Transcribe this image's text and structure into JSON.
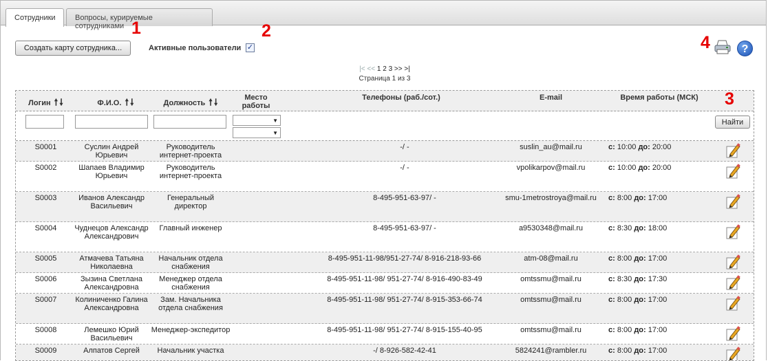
{
  "tabs": [
    {
      "label": "Сотрудники",
      "active": true
    },
    {
      "label": "Вопросы, курируемые сотрудниками",
      "active": false
    }
  ],
  "annotations": [
    "1",
    "2",
    "3",
    "4"
  ],
  "toolbar": {
    "create_button": "Создать карту сотрудника...",
    "active_users_label": "Активные пользователи",
    "active_users_checked": true
  },
  "icons": {
    "print": "printer-icon",
    "help": "help-icon",
    "help_glyph": "?",
    "check_glyph": "✓"
  },
  "pager": {
    "first": "|<",
    "prev": "<<",
    "pages": [
      "1",
      "2",
      "3"
    ],
    "next": ">>",
    "last": ">|",
    "summary": "Страница 1 из 3"
  },
  "table": {
    "headers": {
      "login": "Логин",
      "fio": "Ф.И.О.",
      "position": "Должность",
      "place": "Место работы",
      "phones": "Телефоны (раб./сот.)",
      "email": "E-mail",
      "hours": "Время работы (МСК)"
    },
    "sort_up": "🠕",
    "sort_down": "🠗",
    "find_button": "Найти",
    "from_label": "с:",
    "to_label": "до:",
    "rows": [
      {
        "login": "S0001",
        "fio": "Суслин Андрей Юрьевич",
        "position": "Руководитель интернет-проекта",
        "phones": "-/ -",
        "email": "suslin_au@mail.ru",
        "from": "10:00",
        "to": "20:00"
      },
      {
        "login": "S0002",
        "fio": "Шапаев Владимир Юрьевич",
        "position": "Руководитель интернет-проекта",
        "phones": "-/ -",
        "email": "vpolikarpov@mail.ru",
        "from": "10:00",
        "to": "20:00"
      },
      {
        "login": "S0003",
        "fio": "Иванов Александр Васильевич",
        "position": "Генеральный директор",
        "phones": "8-495-951-63-97/ -",
        "email": "smu-1metrostroya@mail.ru",
        "from": "8:00",
        "to": "17:00"
      },
      {
        "login": "S0004",
        "fio": "Чуднецов Александр Александрович",
        "position": "Главный инженер",
        "phones": "8-495-951-63-97/ -",
        "email": "a9530348@mail.ru",
        "from": "8:30",
        "to": "18:00"
      },
      {
        "login": "S0005",
        "fio": "Атмачева Татьяна Николаевна",
        "position": "Начальник отдела снабжения",
        "phones": "8-495-951-11-98/951-27-74/ 8-916-218-93-66",
        "email": "atm-08@mail.ru",
        "from": "8:00",
        "to": "17:00"
      },
      {
        "login": "S0006",
        "fio": "Зызина Светлана Александровна",
        "position": "Менеджер отдела снабжения",
        "phones": "8-495-951-11-98/ 951-27-74/ 8-916-490-83-49",
        "email": "omtssmu@mail.ru",
        "from": "8:30",
        "to": "17:30"
      },
      {
        "login": "S0007",
        "fio": "Колиниченко Галина Александровна",
        "position": "Зам. Начальника отдела снабжения",
        "phones": "8-495-951-11-98/ 951-27-74/ 8-915-353-66-74",
        "email": "omtssmu@mail.ru",
        "from": "8:00",
        "to": "17:00"
      },
      {
        "login": "S0008",
        "fio": "Лемешко Юрий Васильевич",
        "position": "Менеджер-экспедитор",
        "phones": "8-495-951-11-98/ 951-27-74/ 8-915-155-40-95",
        "email": "omtssmu@mail.ru",
        "from": "8:00",
        "to": "17:00"
      },
      {
        "login": "S0009",
        "fio": "Алпатов Сергей",
        "position": "Начальник участка",
        "phones": "-/ 8-926-582-42-41",
        "email": "5824241@rambler.ru",
        "from": "8:00",
        "to": "17:00"
      }
    ]
  }
}
